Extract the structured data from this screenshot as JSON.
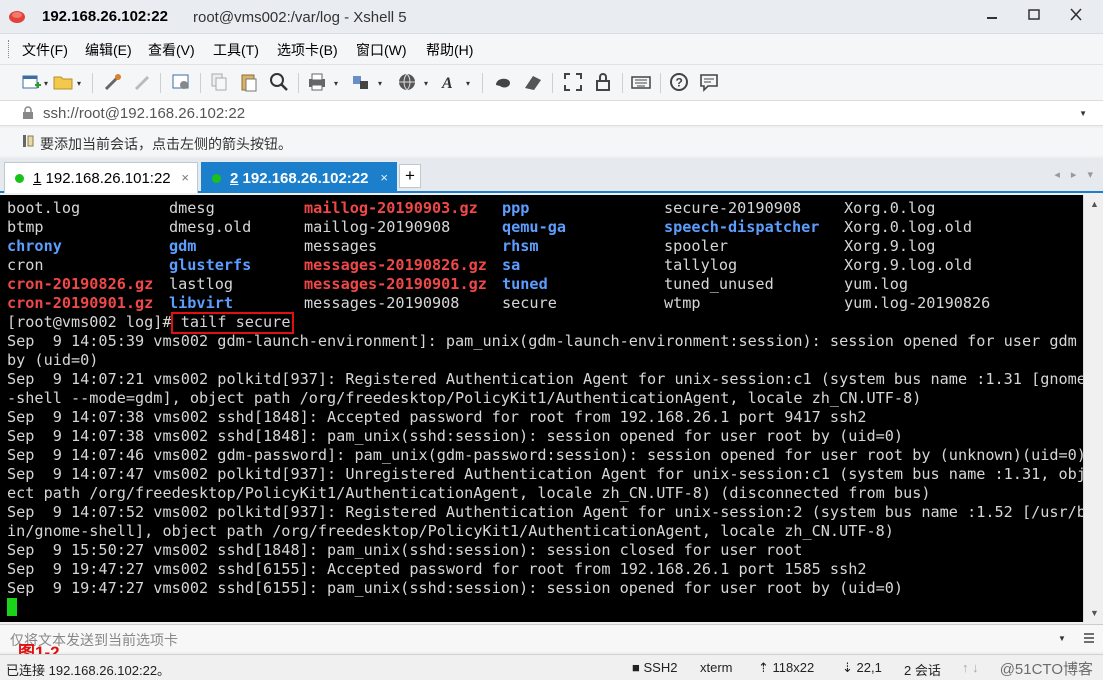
{
  "window": {
    "title_host": "192.168.26.102:22",
    "title_path": "root@vms002:/var/log - Xshell 5"
  },
  "menu": [
    "文件(F)",
    "编辑(E)",
    "查看(V)",
    "工具(T)",
    "选项卡(B)",
    "窗口(W)",
    "帮助(H)"
  ],
  "toolbar": {
    "icons": [
      "new-session-icon",
      "open-folder-icon",
      "reconnect-icon",
      "disconnect-icon",
      "properties-icon",
      "copy-icon",
      "paste-icon",
      "find-icon",
      "print-icon",
      "transfer-icon",
      "globe-icon",
      "font-icon",
      "xftp-icon",
      "xmanager-icon",
      "fullscreen-icon",
      "lock-icon",
      "keyboard-icon",
      "help-icon",
      "chat-icon"
    ]
  },
  "address": {
    "value": "ssh://root@192.168.26.102:22"
  },
  "hint": {
    "text": "要添加当前会话，点击左侧的箭头按钮。"
  },
  "tabs": [
    {
      "number": "1",
      "label": "192.168.26.101:22",
      "active": false,
      "status_color": "#19c119"
    },
    {
      "number": "2",
      "label": "192.168.26.102:22",
      "active": true,
      "status_color": "#19c119"
    }
  ],
  "terminal": {
    "listing": [
      [
        "boot.log",
        "dmesg",
        "maillog-20190903.gz",
        "ppp",
        "secure-20190908",
        "Xorg.0.log"
      ],
      [
        "btmp",
        "dmesg.old",
        "maillog-20190908",
        "qemu-ga",
        "speech-dispatcher",
        "Xorg.0.log.old"
      ],
      [
        "chrony",
        "gdm",
        "messages",
        "rhsm",
        "spooler",
        "Xorg.9.log"
      ],
      [
        "cron",
        "glusterfs",
        "messages-20190826.gz",
        "sa",
        "tallylog",
        "Xorg.9.log.old"
      ],
      [
        "cron-20190826.gz",
        "lastlog",
        "messages-20190901.gz",
        "tuned",
        "tuned_unused",
        "yum.log"
      ],
      [
        "cron-20190901.gz",
        "libvirt",
        "messages-20190908",
        "secure",
        "wtmp",
        "yum.log-20190826"
      ]
    ],
    "prompt": "[root@vms002 log]#",
    "command": "tailf secure",
    "output": [
      "Sep  9 14:05:39 vms002 gdm-launch-environment]: pam_unix(gdm-launch-environment:session): session opened for user gdm",
      "by (uid=0)",
      "Sep  9 14:07:21 vms002 polkitd[937]: Registered Authentication Agent for unix-session:c1 (system bus name :1.31 [gnome",
      "-shell --mode=gdm], object path /org/freedesktop/PolicyKit1/AuthenticationAgent, locale zh_CN.UTF-8)",
      "Sep  9 14:07:38 vms002 sshd[1848]: Accepted password for root from 192.168.26.1 port 9417 ssh2",
      "Sep  9 14:07:38 vms002 sshd[1848]: pam_unix(sshd:session): session opened for user root by (uid=0)",
      "Sep  9 14:07:46 vms002 gdm-password]: pam_unix(gdm-password:session): session opened for user root by (unknown)(uid=0)",
      "Sep  9 14:07:47 vms002 polkitd[937]: Unregistered Authentication Agent for unix-session:c1 (system bus name :1.31, obj",
      "ect path /org/freedesktop/PolicyKit1/AuthenticationAgent, locale zh_CN.UTF-8) (disconnected from bus)",
      "Sep  9 14:07:52 vms002 polkitd[937]: Registered Authentication Agent for unix-session:2 (system bus name :1.52 [/usr/b",
      "in/gnome-shell], object path /org/freedesktop/PolicyKit1/AuthenticationAgent, locale zh_CN.UTF-8)",
      "Sep  9 15:50:27 vms002 sshd[1848]: pam_unix(sshd:session): session closed for user root",
      "Sep  9 19:47:27 vms002 sshd[6155]: Accepted password for root from 192.168.26.1 port 1585 ssh2",
      "Sep  9 19:47:27 vms002 sshd[6155]: pam_unix(sshd:session): session opened for user root by (uid=0)"
    ]
  },
  "compose": {
    "placeholder": "仅将文本发送到当前选项卡"
  },
  "figure_label": "图1-2",
  "status": {
    "connection": "已连接 192.168.26.102:22。",
    "protocol": "SSH2",
    "term": "xterm",
    "size": "118x22",
    "cursor_pos": "22,1",
    "sessions": "2 会话",
    "watermark": "@51CTO博客"
  },
  "colors": {
    "accent": "#1b7fcc",
    "red_file": "#f04848",
    "blue_dir": "#5c9eff",
    "cursor": "#19d419"
  }
}
